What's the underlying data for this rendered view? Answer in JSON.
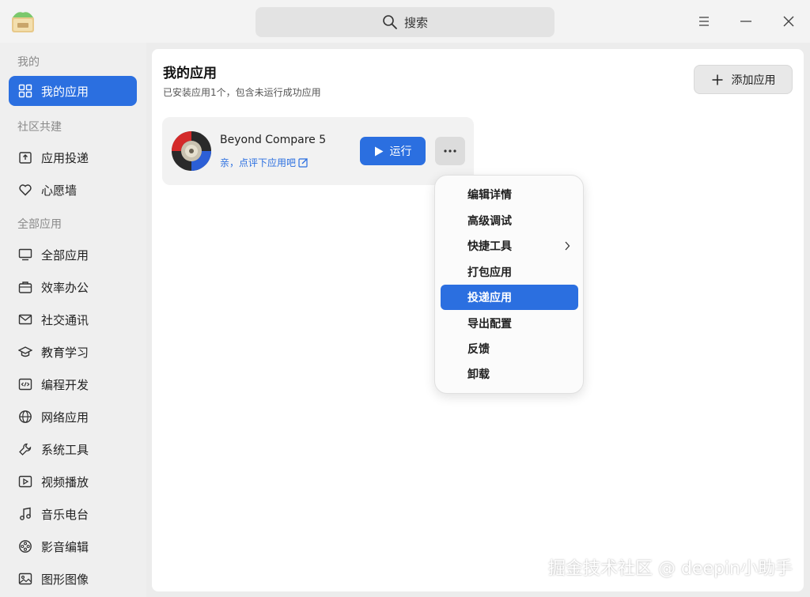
{
  "titlebar": {
    "search_placeholder": "搜索"
  },
  "sidebar": {
    "sections": [
      {
        "title": "我的"
      },
      {
        "title": "社区共建"
      },
      {
        "title": "全部应用"
      }
    ],
    "items": [
      {
        "label": "我的应用",
        "icon": "grid-icon",
        "active": true
      },
      {
        "label": "应用投递",
        "icon": "upload-box-icon"
      },
      {
        "label": "心愿墙",
        "icon": "heart-icon"
      },
      {
        "label": "全部应用",
        "icon": "monitor-icon"
      },
      {
        "label": "效率办公",
        "icon": "briefcase-icon"
      },
      {
        "label": "社交通讯",
        "icon": "mail-icon"
      },
      {
        "label": "教育学习",
        "icon": "graduation-cap-icon"
      },
      {
        "label": "编程开发",
        "icon": "code-icon"
      },
      {
        "label": "网络应用",
        "icon": "globe-icon"
      },
      {
        "label": "系统工具",
        "icon": "wrench-icon"
      },
      {
        "label": "视频播放",
        "icon": "video-icon"
      },
      {
        "label": "音乐电台",
        "icon": "music-icon"
      },
      {
        "label": "影音编辑",
        "icon": "film-reel-icon"
      },
      {
        "label": "图形图像",
        "icon": "image-icon"
      }
    ]
  },
  "main": {
    "title": "我的应用",
    "subtitle": "已安装应用1个，包含未运行成功应用",
    "add_button": "添加应用",
    "app": {
      "name": "Beyond Compare 5",
      "rate_prompt": "亲，点评下应用吧",
      "run_button": "运行"
    }
  },
  "context_menu": {
    "items": [
      {
        "label": "编辑详情"
      },
      {
        "label": "高级调试"
      },
      {
        "label": "快捷工具",
        "has_submenu": true
      },
      {
        "label": "打包应用"
      },
      {
        "label": "投递应用",
        "selected": true
      },
      {
        "label": "导出配置"
      },
      {
        "label": "反馈"
      },
      {
        "label": "卸载"
      }
    ]
  },
  "watermark": "掘金技术社区 @ deepin小助手",
  "colors": {
    "accent": "#2b6fe0",
    "sidebar_bg": "#efefef",
    "window_bg": "#ececec"
  }
}
